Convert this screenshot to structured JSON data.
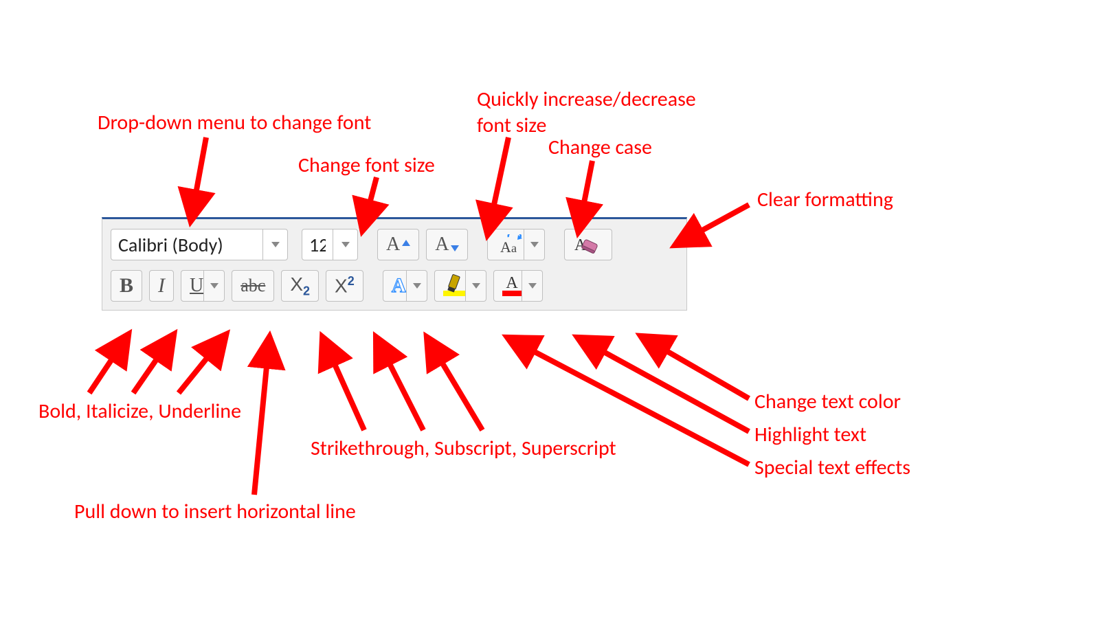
{
  "toolbar": {
    "font_name_value": "Calibri (Body)",
    "font_size_value": "12"
  },
  "labels": {
    "font_menu": "Drop-down menu to change font",
    "font_size": "Change font size",
    "quick_size": "Quickly increase/decrease\nfont size",
    "change_case": "Change case",
    "clear_fmt": "Clear formatting",
    "biu": "Bold, Italicize, Underline",
    "hline": "Pull down to insert horizontal line",
    "strike_sub_sup": "Strikethrough, Subscript, Superscript",
    "text_color": "Change text color",
    "highlight": "Highlight text",
    "effects": "Special text effects"
  },
  "icon_glyphs": {
    "bold": "B",
    "italic": "I",
    "underline": "U",
    "strike": "abc",
    "sub_base": "X",
    "sub_sub": "2",
    "sup_base": "X",
    "sup_sup": "2",
    "grow_A": "A",
    "shrink_A": "A",
    "case_A": "A",
    "case_a": "a",
    "clear_A": "A",
    "effect_A": "A",
    "color_A": "A"
  }
}
